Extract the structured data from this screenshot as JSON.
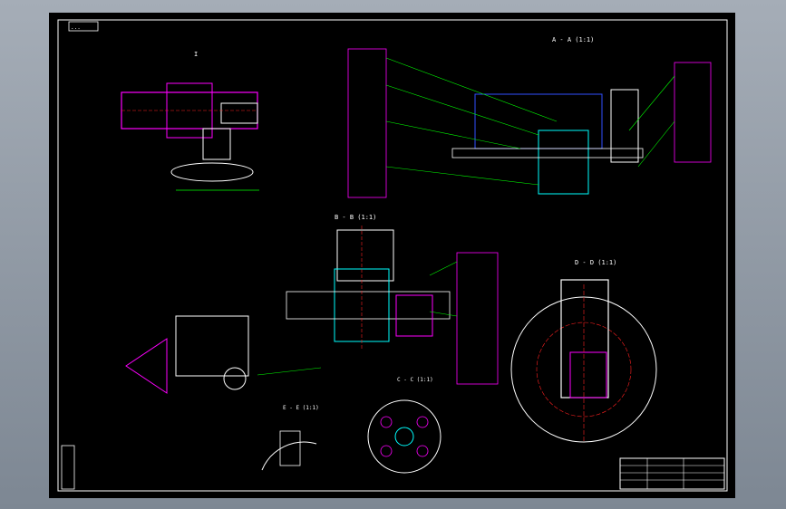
{
  "drawing": {
    "title_tag": "...",
    "section_views": [
      {
        "id": "top-left-view",
        "label": "I"
      },
      {
        "id": "top-right-section",
        "label": "A - A (1:1)"
      },
      {
        "id": "middle-section",
        "label": "B - B (1:1)"
      },
      {
        "id": "bottom-right-section",
        "label": "D - D (1:1)"
      },
      {
        "id": "bottom-center-view",
        "label": "C - C (1:1)"
      },
      {
        "id": "detail-view",
        "label": "E - E (1:1)"
      }
    ],
    "colors": {
      "sheet_bg": "#000000",
      "frame": "#ffffff",
      "leader": "#00ff00",
      "part_magenta": "#ff00ff",
      "part_cyan": "#00ffff",
      "part_red": "#ff2020",
      "part_yellow": "#ffff00",
      "part_blue": "#3050ff"
    },
    "title_block": {
      "rows": 5,
      "cols": 6
    }
  }
}
